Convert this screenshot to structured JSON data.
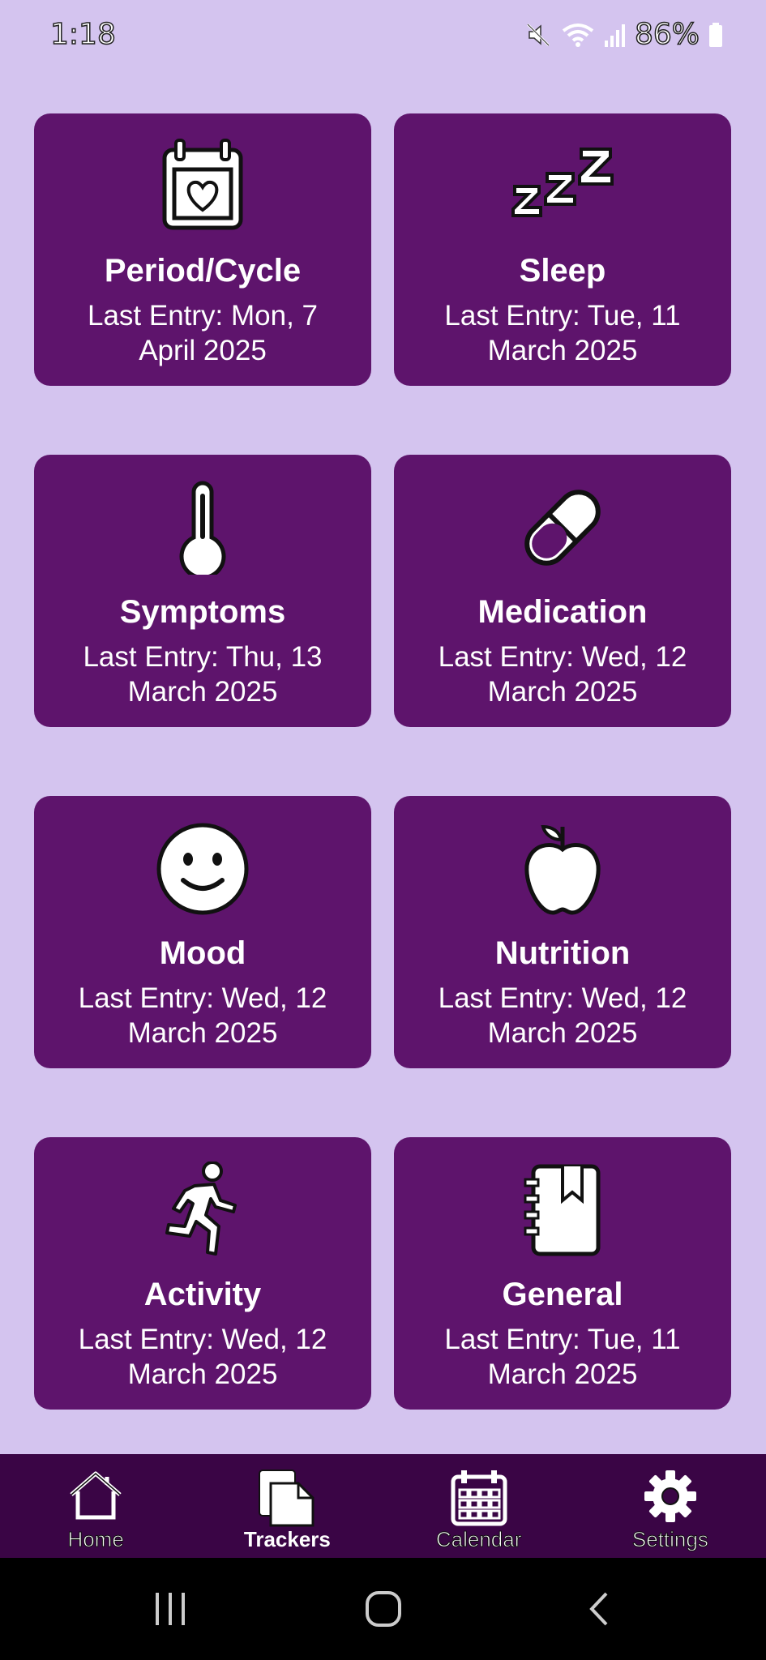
{
  "status": {
    "time": "1:18",
    "battery": "86%"
  },
  "trackers": [
    {
      "title": "Period/Cycle",
      "line1": "Last Entry: Mon, 7",
      "line2": "April 2025",
      "icon": "calendar-heart-icon"
    },
    {
      "title": "Sleep",
      "line1": "Last Entry: Tue, 11",
      "line2": "March 2025",
      "icon": "zzz-icon"
    },
    {
      "title": "Symptoms",
      "line1": "Last Entry: Thu, 13",
      "line2": "March 2025",
      "icon": "thermometer-icon"
    },
    {
      "title": "Medication",
      "line1": "Last Entry: Wed, 12",
      "line2": "March 2025",
      "icon": "pill-icon"
    },
    {
      "title": "Mood",
      "line1": "Last Entry: Wed, 12",
      "line2": "March 2025",
      "icon": "smiley-icon"
    },
    {
      "title": "Nutrition",
      "line1": "Last Entry: Wed, 12",
      "line2": "March 2025",
      "icon": "apple-icon"
    },
    {
      "title": "Activity",
      "line1": "Last Entry: Wed, 12",
      "line2": "March 2025",
      "icon": "running-person-icon"
    },
    {
      "title": "General",
      "line1": "Last Entry: Tue, 11",
      "line2": "March 2025",
      "icon": "notebook-icon"
    }
  ],
  "nav": {
    "home": "Home",
    "trackers": "Trackers",
    "calendar": "Calendar",
    "settings": "Settings",
    "active": "Trackers"
  },
  "colors": {
    "background": "#d4c4ef",
    "card": "#5e146c",
    "nav": "#3a0545"
  }
}
